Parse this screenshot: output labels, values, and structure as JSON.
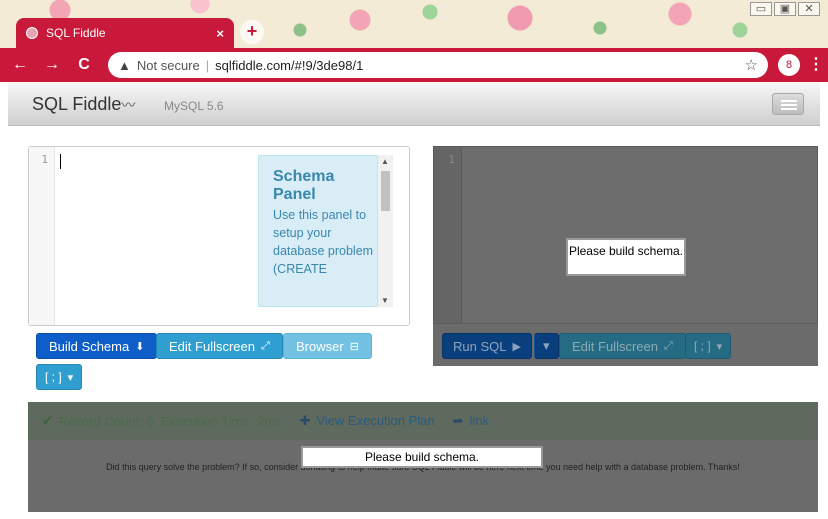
{
  "browser": {
    "tab_title": "SQL Fiddle",
    "tab_close": "×",
    "new_tab": "+",
    "back": "←",
    "forward": "→",
    "reload": "C",
    "security_icon": "warning-triangle-icon",
    "security_text": "Not secure",
    "url": "sqlfiddle.com/#!9/3de98/1",
    "bookmark": "☆",
    "profile_initial": "8",
    "menu": "⋮",
    "window_controls": [
      "▭",
      "▣",
      "✕"
    ]
  },
  "app": {
    "brand": "SQL Fiddle",
    "db_version": "MySQL 5.6"
  },
  "schema_panel": {
    "line_number": "1",
    "help_title": "Schema Panel",
    "help_text": "Use this panel to setup your database problem (CREATE"
  },
  "schema_buttons": {
    "build_schema": "Build Schema",
    "edit_fullscreen": "Edit Fullscreen",
    "browser": "Browser",
    "separator": "[ ; ]"
  },
  "query_panel": {
    "line_number": "1",
    "overlay": "Please build schema.",
    "run_sql": "Run SQL",
    "edit_fullscreen": "Edit Fullscreen",
    "separator": "[ ; ]"
  },
  "results": {
    "status": "Record Count: 0; Execution Time: 2ms",
    "view_plan": "View Execution Plan",
    "link": "link",
    "overlay": "Please build schema.",
    "note": "Did this query solve the problem? If so, consider donating to help make sure SQL Fiddle will be here next time you need help with a database problem. Thanks!"
  }
}
